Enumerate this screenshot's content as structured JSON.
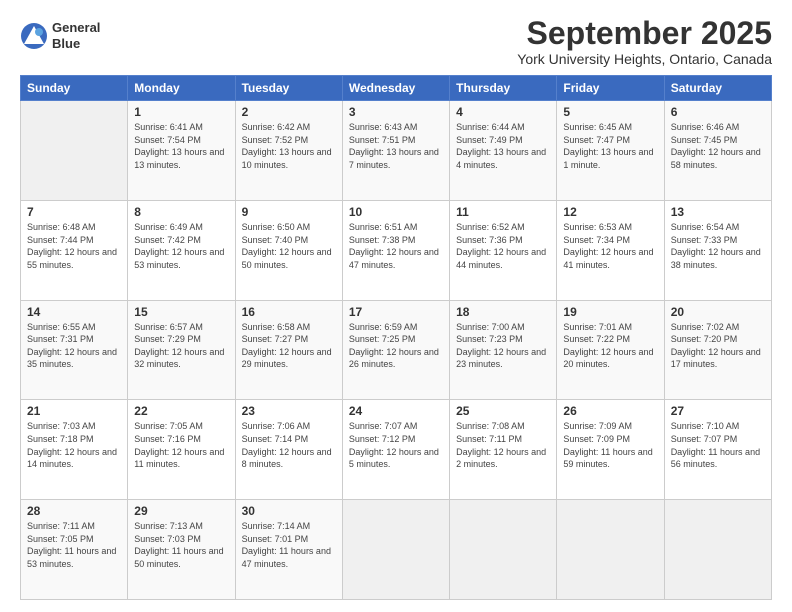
{
  "header": {
    "logo_line1": "General",
    "logo_line2": "Blue",
    "month": "September 2025",
    "location": "York University Heights, Ontario, Canada"
  },
  "weekdays": [
    "Sunday",
    "Monday",
    "Tuesday",
    "Wednesday",
    "Thursday",
    "Friday",
    "Saturday"
  ],
  "weeks": [
    [
      {
        "day": "",
        "sunrise": "",
        "sunset": "",
        "daylight": ""
      },
      {
        "day": "1",
        "sunrise": "Sunrise: 6:41 AM",
        "sunset": "Sunset: 7:54 PM",
        "daylight": "Daylight: 13 hours and 13 minutes."
      },
      {
        "day": "2",
        "sunrise": "Sunrise: 6:42 AM",
        "sunset": "Sunset: 7:52 PM",
        "daylight": "Daylight: 13 hours and 10 minutes."
      },
      {
        "day": "3",
        "sunrise": "Sunrise: 6:43 AM",
        "sunset": "Sunset: 7:51 PM",
        "daylight": "Daylight: 13 hours and 7 minutes."
      },
      {
        "day": "4",
        "sunrise": "Sunrise: 6:44 AM",
        "sunset": "Sunset: 7:49 PM",
        "daylight": "Daylight: 13 hours and 4 minutes."
      },
      {
        "day": "5",
        "sunrise": "Sunrise: 6:45 AM",
        "sunset": "Sunset: 7:47 PM",
        "daylight": "Daylight: 13 hours and 1 minute."
      },
      {
        "day": "6",
        "sunrise": "Sunrise: 6:46 AM",
        "sunset": "Sunset: 7:45 PM",
        "daylight": "Daylight: 12 hours and 58 minutes."
      }
    ],
    [
      {
        "day": "7",
        "sunrise": "Sunrise: 6:48 AM",
        "sunset": "Sunset: 7:44 PM",
        "daylight": "Daylight: 12 hours and 55 minutes."
      },
      {
        "day": "8",
        "sunrise": "Sunrise: 6:49 AM",
        "sunset": "Sunset: 7:42 PM",
        "daylight": "Daylight: 12 hours and 53 minutes."
      },
      {
        "day": "9",
        "sunrise": "Sunrise: 6:50 AM",
        "sunset": "Sunset: 7:40 PM",
        "daylight": "Daylight: 12 hours and 50 minutes."
      },
      {
        "day": "10",
        "sunrise": "Sunrise: 6:51 AM",
        "sunset": "Sunset: 7:38 PM",
        "daylight": "Daylight: 12 hours and 47 minutes."
      },
      {
        "day": "11",
        "sunrise": "Sunrise: 6:52 AM",
        "sunset": "Sunset: 7:36 PM",
        "daylight": "Daylight: 12 hours and 44 minutes."
      },
      {
        "day": "12",
        "sunrise": "Sunrise: 6:53 AM",
        "sunset": "Sunset: 7:34 PM",
        "daylight": "Daylight: 12 hours and 41 minutes."
      },
      {
        "day": "13",
        "sunrise": "Sunrise: 6:54 AM",
        "sunset": "Sunset: 7:33 PM",
        "daylight": "Daylight: 12 hours and 38 minutes."
      }
    ],
    [
      {
        "day": "14",
        "sunrise": "Sunrise: 6:55 AM",
        "sunset": "Sunset: 7:31 PM",
        "daylight": "Daylight: 12 hours and 35 minutes."
      },
      {
        "day": "15",
        "sunrise": "Sunrise: 6:57 AM",
        "sunset": "Sunset: 7:29 PM",
        "daylight": "Daylight: 12 hours and 32 minutes."
      },
      {
        "day": "16",
        "sunrise": "Sunrise: 6:58 AM",
        "sunset": "Sunset: 7:27 PM",
        "daylight": "Daylight: 12 hours and 29 minutes."
      },
      {
        "day": "17",
        "sunrise": "Sunrise: 6:59 AM",
        "sunset": "Sunset: 7:25 PM",
        "daylight": "Daylight: 12 hours and 26 minutes."
      },
      {
        "day": "18",
        "sunrise": "Sunrise: 7:00 AM",
        "sunset": "Sunset: 7:23 PM",
        "daylight": "Daylight: 12 hours and 23 minutes."
      },
      {
        "day": "19",
        "sunrise": "Sunrise: 7:01 AM",
        "sunset": "Sunset: 7:22 PM",
        "daylight": "Daylight: 12 hours and 20 minutes."
      },
      {
        "day": "20",
        "sunrise": "Sunrise: 7:02 AM",
        "sunset": "Sunset: 7:20 PM",
        "daylight": "Daylight: 12 hours and 17 minutes."
      }
    ],
    [
      {
        "day": "21",
        "sunrise": "Sunrise: 7:03 AM",
        "sunset": "Sunset: 7:18 PM",
        "daylight": "Daylight: 12 hours and 14 minutes."
      },
      {
        "day": "22",
        "sunrise": "Sunrise: 7:05 AM",
        "sunset": "Sunset: 7:16 PM",
        "daylight": "Daylight: 12 hours and 11 minutes."
      },
      {
        "day": "23",
        "sunrise": "Sunrise: 7:06 AM",
        "sunset": "Sunset: 7:14 PM",
        "daylight": "Daylight: 12 hours and 8 minutes."
      },
      {
        "day": "24",
        "sunrise": "Sunrise: 7:07 AM",
        "sunset": "Sunset: 7:12 PM",
        "daylight": "Daylight: 12 hours and 5 minutes."
      },
      {
        "day": "25",
        "sunrise": "Sunrise: 7:08 AM",
        "sunset": "Sunset: 7:11 PM",
        "daylight": "Daylight: 12 hours and 2 minutes."
      },
      {
        "day": "26",
        "sunrise": "Sunrise: 7:09 AM",
        "sunset": "Sunset: 7:09 PM",
        "daylight": "Daylight: 11 hours and 59 minutes."
      },
      {
        "day": "27",
        "sunrise": "Sunrise: 7:10 AM",
        "sunset": "Sunset: 7:07 PM",
        "daylight": "Daylight: 11 hours and 56 minutes."
      }
    ],
    [
      {
        "day": "28",
        "sunrise": "Sunrise: 7:11 AM",
        "sunset": "Sunset: 7:05 PM",
        "daylight": "Daylight: 11 hours and 53 minutes."
      },
      {
        "day": "29",
        "sunrise": "Sunrise: 7:13 AM",
        "sunset": "Sunset: 7:03 PM",
        "daylight": "Daylight: 11 hours and 50 minutes."
      },
      {
        "day": "30",
        "sunrise": "Sunrise: 7:14 AM",
        "sunset": "Sunset: 7:01 PM",
        "daylight": "Daylight: 11 hours and 47 minutes."
      },
      {
        "day": "",
        "sunrise": "",
        "sunset": "",
        "daylight": ""
      },
      {
        "day": "",
        "sunrise": "",
        "sunset": "",
        "daylight": ""
      },
      {
        "day": "",
        "sunrise": "",
        "sunset": "",
        "daylight": ""
      },
      {
        "day": "",
        "sunrise": "",
        "sunset": "",
        "daylight": ""
      }
    ]
  ]
}
